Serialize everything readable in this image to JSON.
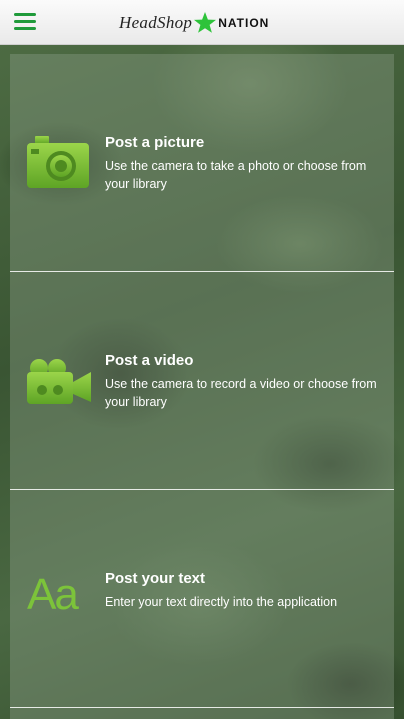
{
  "header": {
    "menu_icon": "hamburger-menu-icon",
    "logo_left": "HeadShop",
    "logo_star_icon": "star-icon",
    "logo_right": "NATION",
    "accent_color": "#1f9a3a"
  },
  "options": [
    {
      "icon": "camera-icon",
      "title": "Post a picture",
      "description": "Use the camera to take a photo or choose from your library"
    },
    {
      "icon": "video-camera-icon",
      "title": "Post a video",
      "description": "Use the camera to record a video or choose from your library"
    },
    {
      "icon": "text-icon",
      "icon_text": "Aa",
      "title": "Post your text",
      "description": "Enter your text directly into the application"
    }
  ],
  "colors": {
    "icon_green": "#7cc33a",
    "text": "#ffffff"
  }
}
